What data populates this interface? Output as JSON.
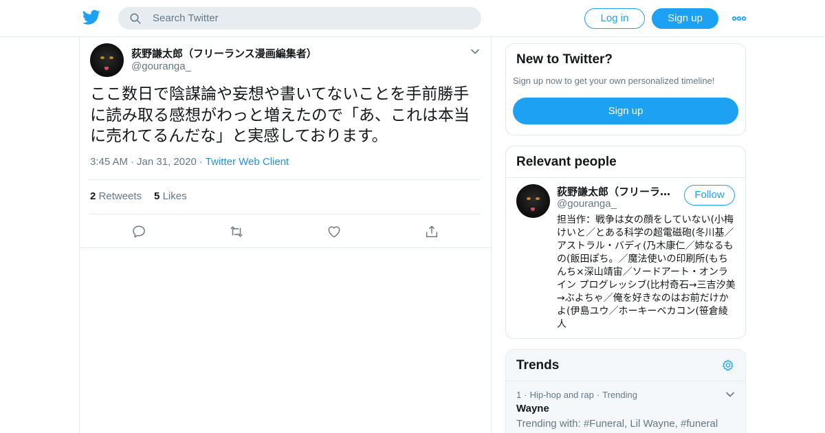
{
  "topbar": {
    "logo": "twitter-bird-icon",
    "search_placeholder": "Search Twitter",
    "login_label": "Log in",
    "signup_label": "Sign up",
    "more_icon": "more-dots-icon"
  },
  "tweet": {
    "author_name": "荻野謙太郎（フリーランス漫画編集者）",
    "author_handle": "@gouranga_",
    "text": "ここ数日で陰謀論や妄想や書いてないことを手前勝手に読み取る感想がわっと増えたので「あ、これは本当に売れてるんだな」と実感しております。",
    "time": "3:45 AM",
    "date": "Jan 31, 2020",
    "client": "Twitter Web Client",
    "retweets_count": "2",
    "retweets_label": "Retweets",
    "likes_count": "5",
    "likes_label": "Likes",
    "actions": [
      "reply-icon",
      "retweet-icon",
      "like-icon",
      "share-icon"
    ]
  },
  "new_to_twitter": {
    "title": "New to Twitter?",
    "subtitle": "Sign up now to get your own personalized timeline!",
    "button": "Sign up"
  },
  "relevant_people": {
    "title": "Relevant people",
    "name": "荻野謙太郎（フリーランス漫画編集者）",
    "handle": "@gouranga_",
    "follow_label": "Follow",
    "bio": "担当作：戦争は女の顔をしていない(小梅けいと／とある科学の超電磁砲(冬川基／アストラル・バディ(乃木康仁／姉なるもの(飯田ぽち。／魔法使いの印刷所(もちんち×深山靖宙／ソードアート・オンライン プログレッシブ(比村奇石→三吉汐美→ぶよちゃ／俺を好きなのはお前だけかよ(伊島ユウ／ホーキーベカコン(笹倉綾人"
  },
  "trends": {
    "title": "Trends",
    "items": [
      {
        "rank": "1",
        "category": "Hip-hop and rap",
        "status": "Trending",
        "name": "Wayne",
        "trending_with": "Trending with: #Funeral, Lil Wayne, #funeral"
      }
    ]
  },
  "colors": {
    "accent": "#1da1f2",
    "link": "#1b95e0",
    "secondary_text": "#657786",
    "border": "#e1e8ed"
  }
}
